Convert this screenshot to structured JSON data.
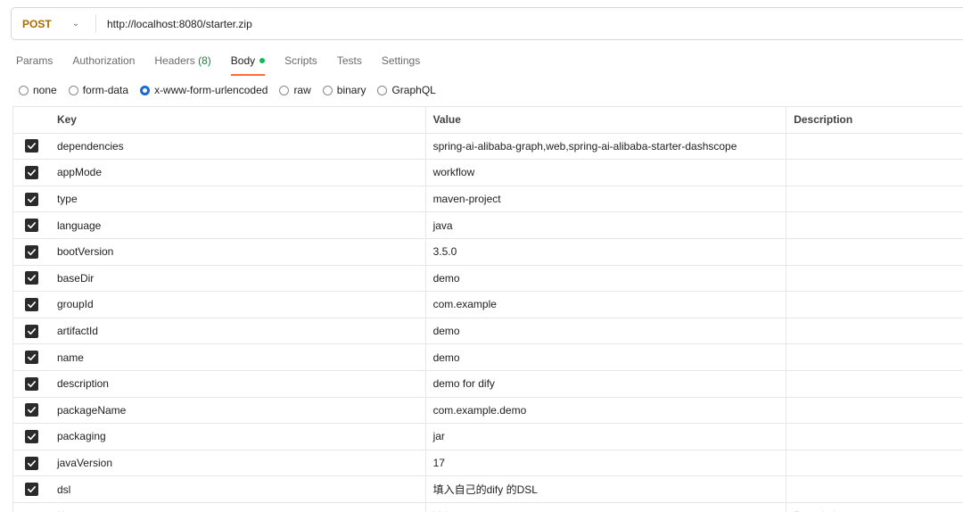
{
  "request": {
    "method": "POST",
    "url": "http://localhost:8080/starter.zip"
  },
  "tabs": [
    {
      "label": "Params"
    },
    {
      "label": "Authorization"
    },
    {
      "label": "Headers",
      "count": "(8)"
    },
    {
      "label": "Body"
    },
    {
      "label": "Scripts"
    },
    {
      "label": "Tests"
    },
    {
      "label": "Settings"
    }
  ],
  "body_types": [
    {
      "label": "none"
    },
    {
      "label": "form-data"
    },
    {
      "label": "x-www-form-urlencoded"
    },
    {
      "label": "raw"
    },
    {
      "label": "binary"
    },
    {
      "label": "GraphQL"
    }
  ],
  "selected_body_type": "x-www-form-urlencoded",
  "table": {
    "headers": {
      "key": "Key",
      "value": "Value",
      "description": "Description"
    },
    "rows": [
      {
        "key": "dependencies",
        "value": "spring-ai-alibaba-graph,web,spring-ai-alibaba-starter-dashscope",
        "checked": true
      },
      {
        "key": "appMode",
        "value": "workflow",
        "checked": true
      },
      {
        "key": "type",
        "value": "maven-project",
        "checked": true
      },
      {
        "key": "language",
        "value": "java",
        "checked": true
      },
      {
        "key": "bootVersion",
        "value": "3.5.0",
        "checked": true
      },
      {
        "key": "baseDir",
        "value": "demo",
        "checked": true
      },
      {
        "key": "groupId",
        "value": "com.example",
        "checked": true
      },
      {
        "key": "artifactId",
        "value": "demo",
        "checked": true
      },
      {
        "key": "name",
        "value": "demo",
        "checked": true
      },
      {
        "key": "description",
        "value": "demo for dify",
        "checked": true
      },
      {
        "key": "packageName",
        "value": "com.example.demo",
        "checked": true
      },
      {
        "key": "packaging",
        "value": "jar",
        "checked": true
      },
      {
        "key": "javaVersion",
        "value": "17",
        "checked": true
      },
      {
        "key": "dsl",
        "value": "填入自己的dify 的DSL",
        "checked": true
      }
    ],
    "placeholder": {
      "key": "Key",
      "value": "Value",
      "description": "Description"
    }
  },
  "colors": {
    "method": "#a86c00",
    "active_tab_underline": "#ff6c37",
    "body_dot": "#0cbb52",
    "headers_count": "#0a8a3c",
    "radio_selected": "#1a6bd6"
  }
}
